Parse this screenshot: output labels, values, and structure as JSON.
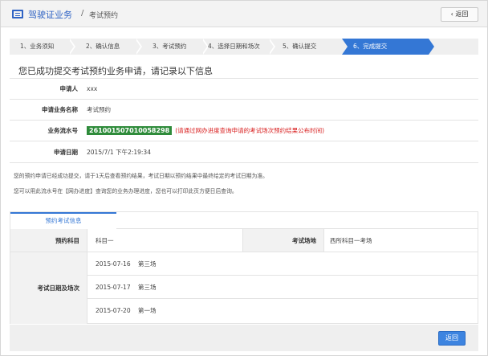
{
  "header": {
    "title": "驾驶证业务",
    "separator": "/",
    "subtitle": "考试预约",
    "back_label": "返回"
  },
  "steps": [
    {
      "label": "1、业务须知",
      "active": false
    },
    {
      "label": "2、确认信息",
      "active": false
    },
    {
      "label": "3、考试预约",
      "active": false
    },
    {
      "label": "4、选择日期和场次",
      "active": false
    },
    {
      "label": "5、确认提交",
      "active": false
    },
    {
      "label": "6、完成提交",
      "active": true
    }
  ],
  "success_message": "您已成功提交考试预约业务申请，请记录以下信息",
  "info": {
    "applicant_label": "申请人",
    "applicant_value": "xxx",
    "business_label": "申请业务名称",
    "business_value": "考试预约",
    "serial_label": "业务流水号",
    "serial_value": "261001507010058298",
    "serial_note": "(请通过网办进度查询申请的考试场次预约结果公布时间)",
    "date_label": "申请日期",
    "date_value": "2015/7/1 下午2:19:34"
  },
  "notices": [
    "您的预约申请已经成功提交，请于1天后查看预约结果，考试日期以预约结果中最终给定的考试日期为准。",
    "您可以用此流水号在【网办进度】查询您的业务办理进度，您也可以打印此页方便日后查询。"
  ],
  "tab": {
    "label": "预约考试信息"
  },
  "exam": {
    "subject_label": "预约科目",
    "subject_value": "科目一",
    "venue_label": "考试场地",
    "venue_value": "西所科目一考场",
    "schedule_label": "考试日期及场次",
    "schedule": [
      {
        "date": "2015-07-16",
        "session": "第三场"
      },
      {
        "date": "2015-07-17",
        "session": "第三场"
      },
      {
        "date": "2015-07-20",
        "session": "第一场"
      }
    ]
  },
  "footer": {
    "return_label": "返回"
  },
  "colors": {
    "accent": "#3477d5",
    "serial_bg": "#2e8b3a",
    "warning_text": "#d81e1e"
  }
}
